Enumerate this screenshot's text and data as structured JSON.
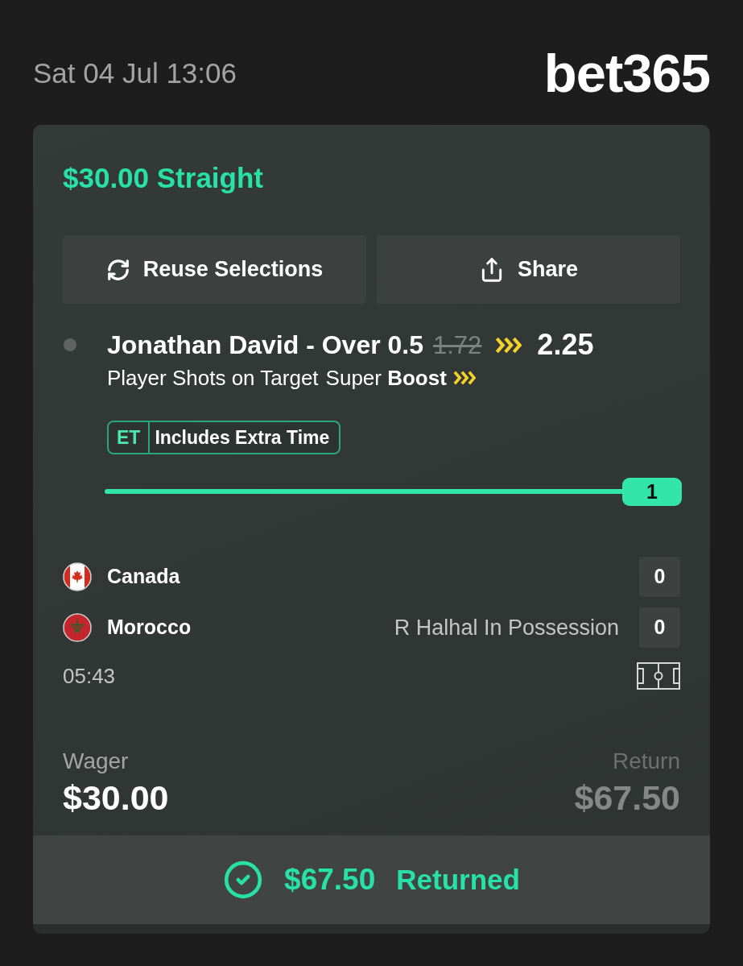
{
  "header": {
    "datetime": "Sat 04 Jul 13:06",
    "logo": "bet365"
  },
  "bet": {
    "title": "$30.00 Straight",
    "actions": [
      {
        "label": "Reuse Selections",
        "kind": "reuse"
      },
      {
        "label": "Share",
        "kind": "share"
      }
    ],
    "selection": {
      "name": "Jonathan David - Over 0.5",
      "old_odds": "1.72",
      "new_odds": "2.25",
      "market": "Player Shots on Target",
      "boost": "Super **Boost**"
    },
    "badge": {
      "code": "ET",
      "label": "Includes Extra Time"
    },
    "slider": {
      "level": 1,
      "value": "1"
    },
    "match": {
      "teams": [
        {
          "name": "Canada",
          "kind": "canada",
          "score": "0"
        },
        {
          "name": "Morocco",
          "kind": "morocco",
          "status": "R Halhal In Possession",
          "score": "0"
        }
      ],
      "clock": "05:43"
    },
    "wager": {
      "label": "Wager",
      "amount": "$30.00"
    },
    "return": {
      "label": "Return",
      "amount": "$67.50"
    },
    "result": {
      "amount": "$67.50",
      "label": "Returned"
    }
  }
}
